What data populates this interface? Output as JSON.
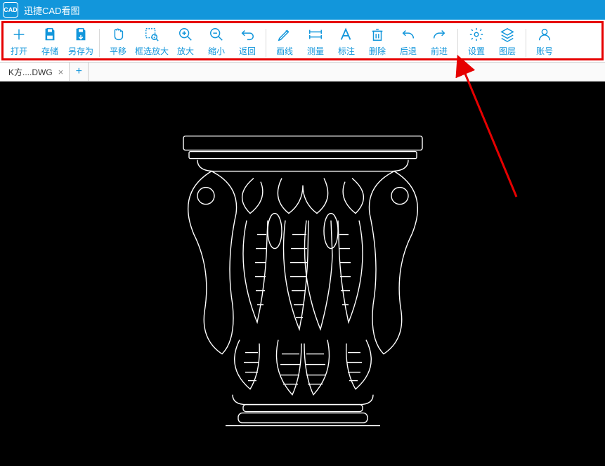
{
  "app": {
    "title": "迅捷CAD看图",
    "logo_text": "CAD"
  },
  "toolbar": {
    "groups": [
      [
        {
          "id": "open",
          "label": "打开",
          "icon": "plus-icon"
        },
        {
          "id": "save",
          "label": "存储",
          "icon": "save-icon"
        },
        {
          "id": "saveas",
          "label": "另存为",
          "icon": "saveas-icon"
        }
      ],
      [
        {
          "id": "pan",
          "label": "平移",
          "icon": "hand-icon"
        },
        {
          "id": "zoomwin",
          "label": "框选放大",
          "icon": "zoom-window-icon",
          "wide": true
        },
        {
          "id": "zoomin",
          "label": "放大",
          "icon": "zoom-in-icon"
        },
        {
          "id": "zoomout",
          "label": "缩小",
          "icon": "zoom-out-icon"
        },
        {
          "id": "return",
          "label": "返回",
          "icon": "return-icon"
        }
      ],
      [
        {
          "id": "drawline",
          "label": "画线",
          "icon": "pencil-icon"
        },
        {
          "id": "measure",
          "label": "测量",
          "icon": "measure-icon"
        },
        {
          "id": "annotate",
          "label": "标注",
          "icon": "text-icon"
        },
        {
          "id": "delete",
          "label": "删除",
          "icon": "trash-icon"
        },
        {
          "id": "undo",
          "label": "后退",
          "icon": "undo-icon"
        },
        {
          "id": "redo",
          "label": "前进",
          "icon": "redo-icon"
        }
      ],
      [
        {
          "id": "settings",
          "label": "设置",
          "icon": "gear-icon"
        },
        {
          "id": "layers",
          "label": "图层",
          "icon": "layers-icon"
        }
      ],
      [
        {
          "id": "account",
          "label": "账号",
          "icon": "user-icon"
        }
      ]
    ]
  },
  "tabs": {
    "items": [
      {
        "name": "K方....DWG"
      }
    ],
    "add_label": "+"
  },
  "colors": {
    "accent": "#1296db",
    "highlight_border": "#e60000"
  }
}
